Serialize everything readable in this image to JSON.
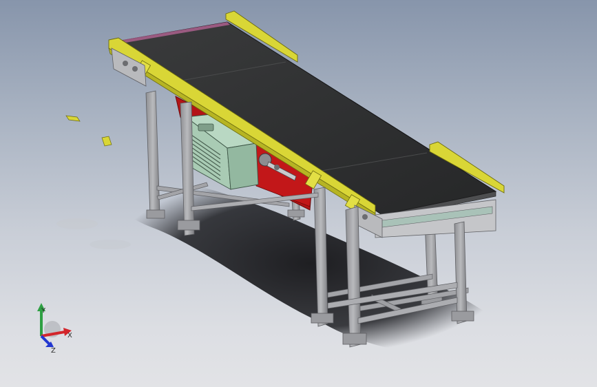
{
  "viewport": {
    "view": "isometric",
    "model": "belt-conveyor-assembly",
    "background_top": "#8795ab",
    "background_bottom": "#e2e3e6"
  },
  "colors": {
    "belt": "#2e2f30",
    "side_rail": "#d9d636",
    "frame_steel": "#a7a8ab",
    "drive_guard": "#b31416",
    "motor_housing": "#a9cbb4"
  },
  "triad": {
    "x_label": "X",
    "y_label": "Y",
    "z_label": "Z",
    "x_color": "#d3252b",
    "y_color": "#2ea043",
    "z_color": "#2237d0"
  }
}
